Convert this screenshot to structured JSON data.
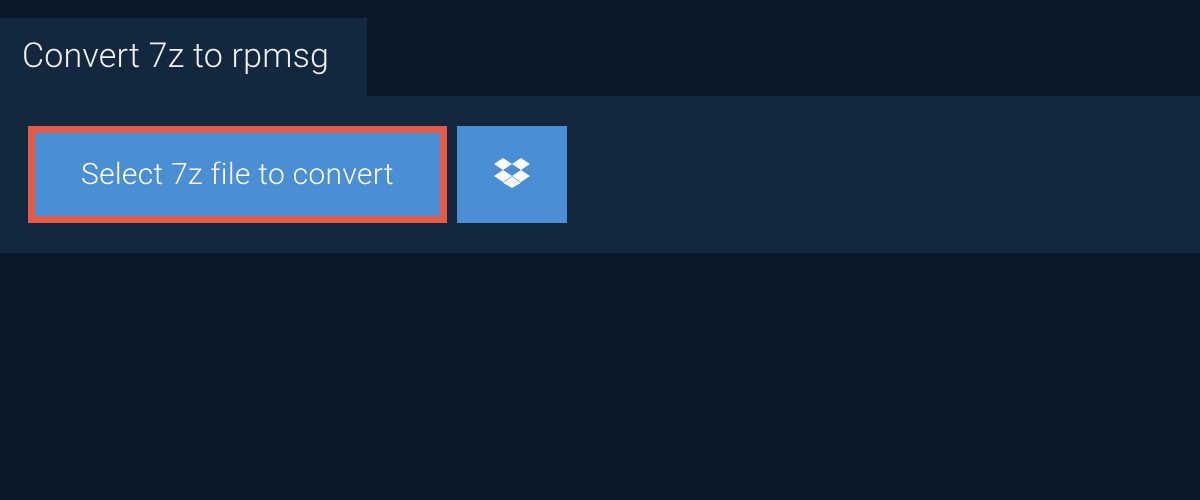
{
  "header": {
    "title": "Convert 7z to rpmsg"
  },
  "actions": {
    "select_file_label": "Select 7z file to convert"
  },
  "colors": {
    "background": "#0a1929",
    "panel": "#13283f",
    "button_primary": "#4a8fd4",
    "highlight_border": "#e35a48",
    "text_light": "#ffffff"
  }
}
